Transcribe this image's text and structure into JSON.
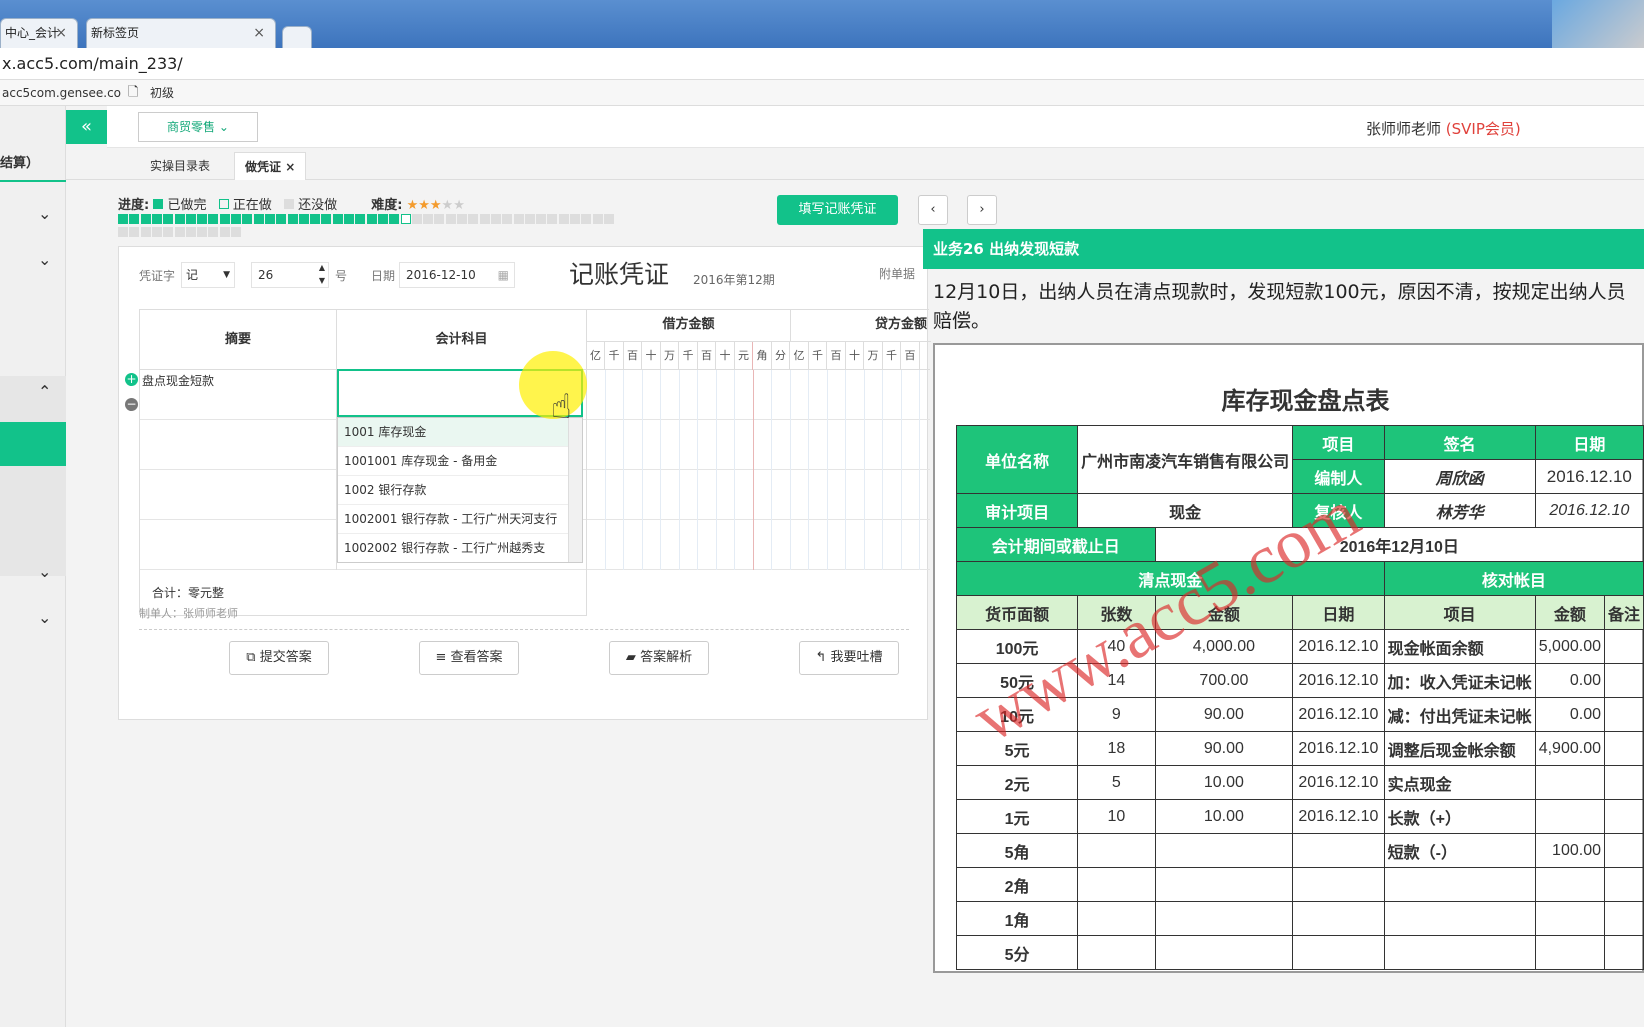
{
  "browser": {
    "tabs": [
      {
        "label": "中心_会计"
      },
      {
        "label": "新标签页"
      }
    ],
    "url": "x.acc5.com/main_233/",
    "bookmarks": [
      {
        "label": "acc5com.gensee.co"
      },
      {
        "label": "初级"
      }
    ]
  },
  "header": {
    "industry": "商贸零售",
    "user_name": "张师师老师",
    "user_level": "(SVIP会员)"
  },
  "sidebar": {
    "partial_label": "结算）"
  },
  "page_tabs": [
    {
      "label": "实操目录表"
    },
    {
      "label": "做凭证"
    }
  ],
  "progress": {
    "label": "进度:",
    "legend": [
      {
        "label": "已做完"
      },
      {
        "label": "正在做"
      },
      {
        "label": "还没做"
      }
    ],
    "difficulty_label": "难度:",
    "difficulty_stars": 3,
    "difficulty_max": 5,
    "done": 25,
    "current": 26,
    "total": 55
  },
  "actions": {
    "fill_voucher": "填写记账凭证"
  },
  "voucher": {
    "type_label": "凭证字",
    "type_value": "记",
    "number": "26",
    "number_unit": "号",
    "date_label": "日期",
    "date_value": "2016-12-10",
    "title": "记账凭证",
    "period": "2016年第12期",
    "attachments_label": "附单据",
    "col_summary": "摘要",
    "col_subject": "会计科目",
    "col_debit": "借方金额",
    "col_credit": "贷方金额",
    "digit_units": [
      "亿",
      "千",
      "百",
      "十",
      "万",
      "千",
      "百",
      "十",
      "元",
      "角",
      "分"
    ],
    "rows": [
      {
        "summary": "盘点现金短款"
      },
      {
        "summary": ""
      },
      {
        "summary": ""
      },
      {
        "summary": ""
      }
    ],
    "total_label": "合计：零元整",
    "maker": "制单人：张师师老师",
    "subject_options": [
      "1001 库存现金",
      "1001001 库存现金 - 备用金",
      "1002 银行存款",
      "1002001 银行存款 - 工行广州天河支行",
      "1002002 银行存款 - 工行广州越秀支"
    ],
    "buttons": {
      "submit": "提交答案",
      "view": "查看答案",
      "analysis": "答案解析",
      "feedback": "我要吐槽"
    }
  },
  "business": {
    "title": "业务26 出纳发现短款",
    "description": "12月10日，出纳人员在清点现款时，发现短款100元，原因不清，按规定出纳人员赔偿。"
  },
  "inventory": {
    "title": "库存现金盘点表",
    "unit_label": "单位名称",
    "unit_value": "广州市南凌汽车销售有限公司",
    "item_label": "项目",
    "sign_label": "签名",
    "date_label": "日期",
    "compiler_label": "编制人",
    "compiler_sign": "周欣函",
    "compiler_date": "2016.12.10",
    "reviewer_label": "复核人",
    "reviewer_sign": "林芳华",
    "reviewer_date": "2016.12.10",
    "audit_label": "审计项目",
    "audit_value": "现金",
    "period_label": "会计期间或截止日",
    "period_value": "2016年12月10日",
    "count_header": "清点现金",
    "check_header": "核对帐目",
    "cols": [
      "货币面额",
      "张数",
      "金额",
      "日期",
      "项目",
      "金额",
      "备注"
    ],
    "rows": [
      {
        "denom": "100元",
        "qty": "40",
        "amt": "4,000.00",
        "date": "2016.12.10",
        "item": "现金帐面余额",
        "item_amt": "5,000.00"
      },
      {
        "denom": "50元",
        "qty": "14",
        "amt": "700.00",
        "date": "2016.12.10",
        "item": "加：收入凭证未记帐",
        "item_amt": "0.00"
      },
      {
        "denom": "10元",
        "qty": "9",
        "amt": "90.00",
        "date": "2016.12.10",
        "item": "减：付出凭证未记帐",
        "item_amt": "0.00"
      },
      {
        "denom": "5元",
        "qty": "18",
        "amt": "90.00",
        "date": "2016.12.10",
        "item": "调整后现金帐余额",
        "item_amt": "4,900.00"
      },
      {
        "denom": "2元",
        "qty": "5",
        "amt": "10.00",
        "date": "2016.12.10",
        "item": "实点现金",
        "item_amt": ""
      },
      {
        "denom": "1元",
        "qty": "10",
        "amt": "10.00",
        "date": "2016.12.10",
        "item": "长款（+）",
        "item_amt": ""
      },
      {
        "denom": "5角",
        "qty": "",
        "amt": "",
        "date": "",
        "item": "短款（-）",
        "item_amt": "100.00"
      },
      {
        "denom": "2角",
        "qty": "",
        "amt": "",
        "date": "",
        "item": "",
        "item_amt": ""
      },
      {
        "denom": "1角",
        "qty": "",
        "amt": "",
        "date": "",
        "item": "",
        "item_amt": ""
      },
      {
        "denom": "5分",
        "qty": "",
        "amt": "",
        "date": "",
        "item": "",
        "item_amt": ""
      }
    ],
    "watermark": "www.acc5.com"
  },
  "colors": {
    "accent": "#12c28a",
    "level": "#e0413b",
    "table_green": "#1ec47a"
  }
}
